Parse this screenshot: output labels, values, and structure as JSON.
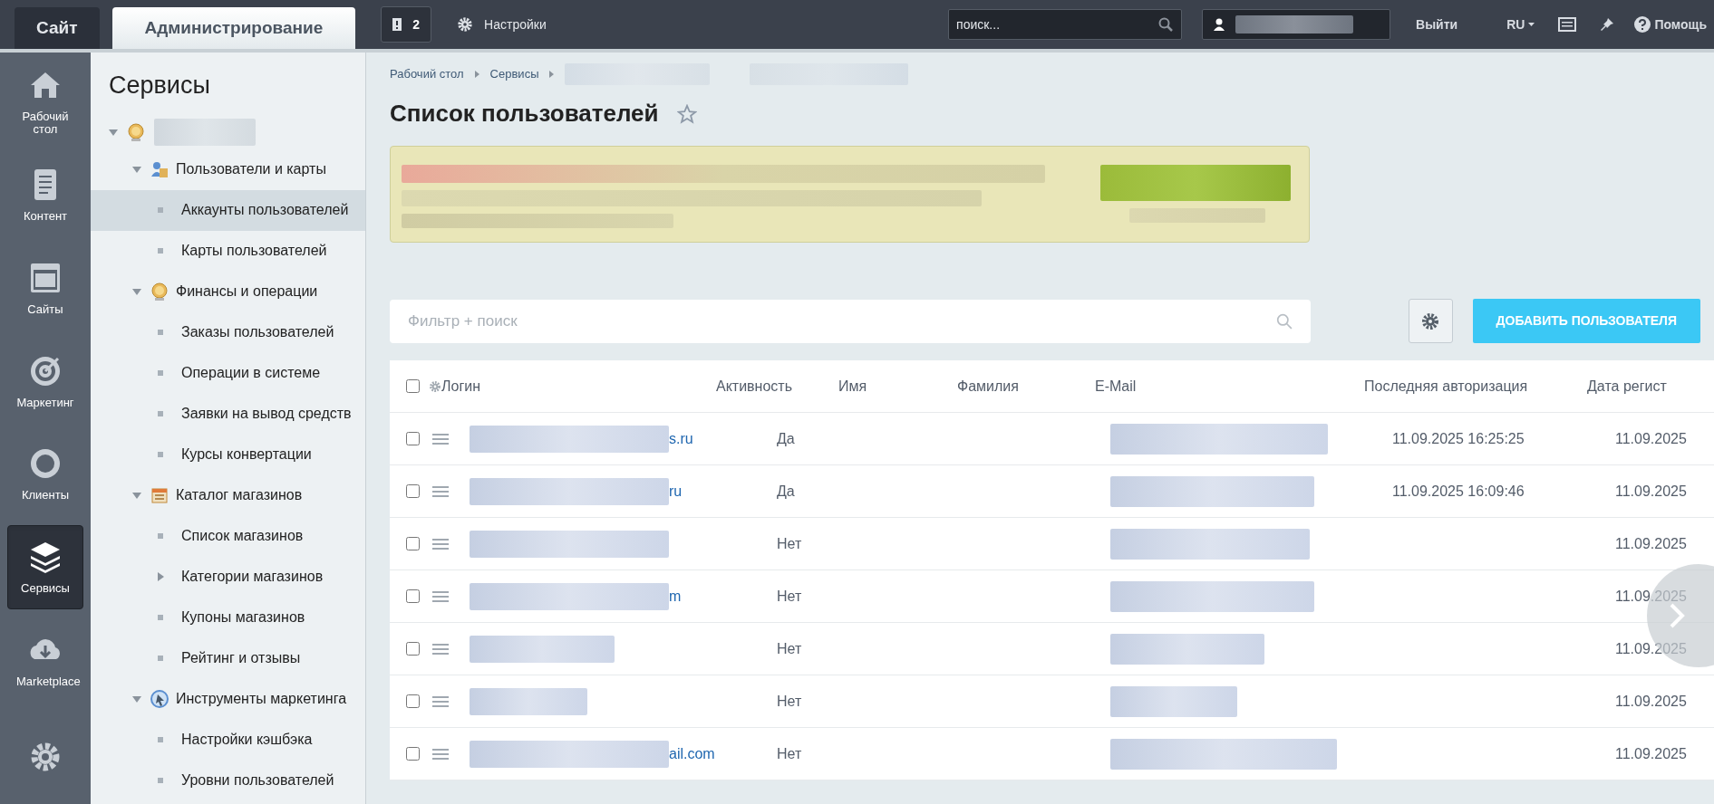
{
  "top_bar": {
    "tabs": [
      {
        "label": "Сайт",
        "selected": false
      },
      {
        "label": "Администрирование",
        "selected": true
      }
    ],
    "notifications": "2",
    "settings": "Настройки",
    "search": {
      "placeholder": "поиск..."
    },
    "logout": "Выйти",
    "language": "RU",
    "help": "Помощь"
  },
  "main_menu": [
    {
      "label": "Рабочий стол",
      "selected": false
    },
    {
      "label": "Контент",
      "selected": false
    },
    {
      "label": "Сайты",
      "selected": false
    },
    {
      "label": "Маркетинг",
      "selected": false
    },
    {
      "label": "Клиенты",
      "selected": false
    },
    {
      "label": "Сервисы",
      "selected": true
    },
    {
      "label": "Marketplace",
      "selected": false
    },
    {
      "selected": false
    }
  ],
  "sidebar": {
    "title": "Сервисы",
    "tree": [
      {
        "expanded": true,
        "children": [
          {
            "label": "Пользователи и карты",
            "expanded": true,
            "children": [
              {
                "label": "Аккаунты пользователей",
                "selected": true
              },
              {
                "label": "Карты пользователей",
                "selected": false
              }
            ]
          },
          {
            "label": "Финансы и операции",
            "expanded": true,
            "children": [
              {
                "label": "Заказы пользователей",
                "selected": false
              },
              {
                "label": "Операции в системе",
                "selected": false
              },
              {
                "label": "Заявки на вывод средств",
                "selected": false
              },
              {
                "label": "Курсы конвертации",
                "selected": false
              }
            ]
          },
          {
            "label": "Каталог магазинов",
            "expanded": true,
            "children": [
              {
                "label": "Список магазинов",
                "selected": false
              },
              {
                "label": "Категории магазинов",
                "selected": false,
                "expanded": false
              },
              {
                "label": "Купоны магазинов",
                "selected": false
              },
              {
                "label": "Рейтинг и отзывы",
                "selected": false
              }
            ]
          },
          {
            "label": "Инструменты маркетинга",
            "expanded": true,
            "children": [
              {
                "label": "Настройки кэшбэка",
                "selected": false
              },
              {
                "label": "Уровни пользователей",
                "selected": false
              }
            ]
          }
        ]
      }
    ]
  },
  "breadcrumbs": [
    "Рабочий стол",
    "Сервисы"
  ],
  "page_title": "Список пользователей",
  "filter": {
    "placeholder": "Фильтр + поиск"
  },
  "add_button": "ДОБАВИТЬ ПОЛЬЗОВАТЕЛЯ",
  "table": {
    "all_checked": false,
    "columns": [
      "Логин",
      "Активность",
      "Имя",
      "Фамилия",
      "E-Mail",
      "Последняя авторизация",
      "Дата регист"
    ],
    "rows": [
      {
        "checked": false,
        "login": "s.ru",
        "active": "Да",
        "last_auth": "11.09.2025 16:25:25",
        "registered": "11.09.2025"
      },
      {
        "checked": false,
        "login": "ru",
        "active": "Да",
        "last_auth": "11.09.2025 16:09:46",
        "registered": "11.09.2025"
      },
      {
        "checked": false,
        "active": "Нет",
        "registered": "11.09.2025"
      },
      {
        "checked": false,
        "login": "m",
        "active": "Нет",
        "registered": "11.09.2025"
      },
      {
        "checked": false,
        "active": "Нет",
        "registered": "11.09.2025"
      },
      {
        "checked": false,
        "active": "Нет",
        "registered": "11.09.2025"
      },
      {
        "checked": false,
        "login": "ail.com",
        "active": "Нет",
        "registered": "11.09.2025"
      }
    ]
  }
}
